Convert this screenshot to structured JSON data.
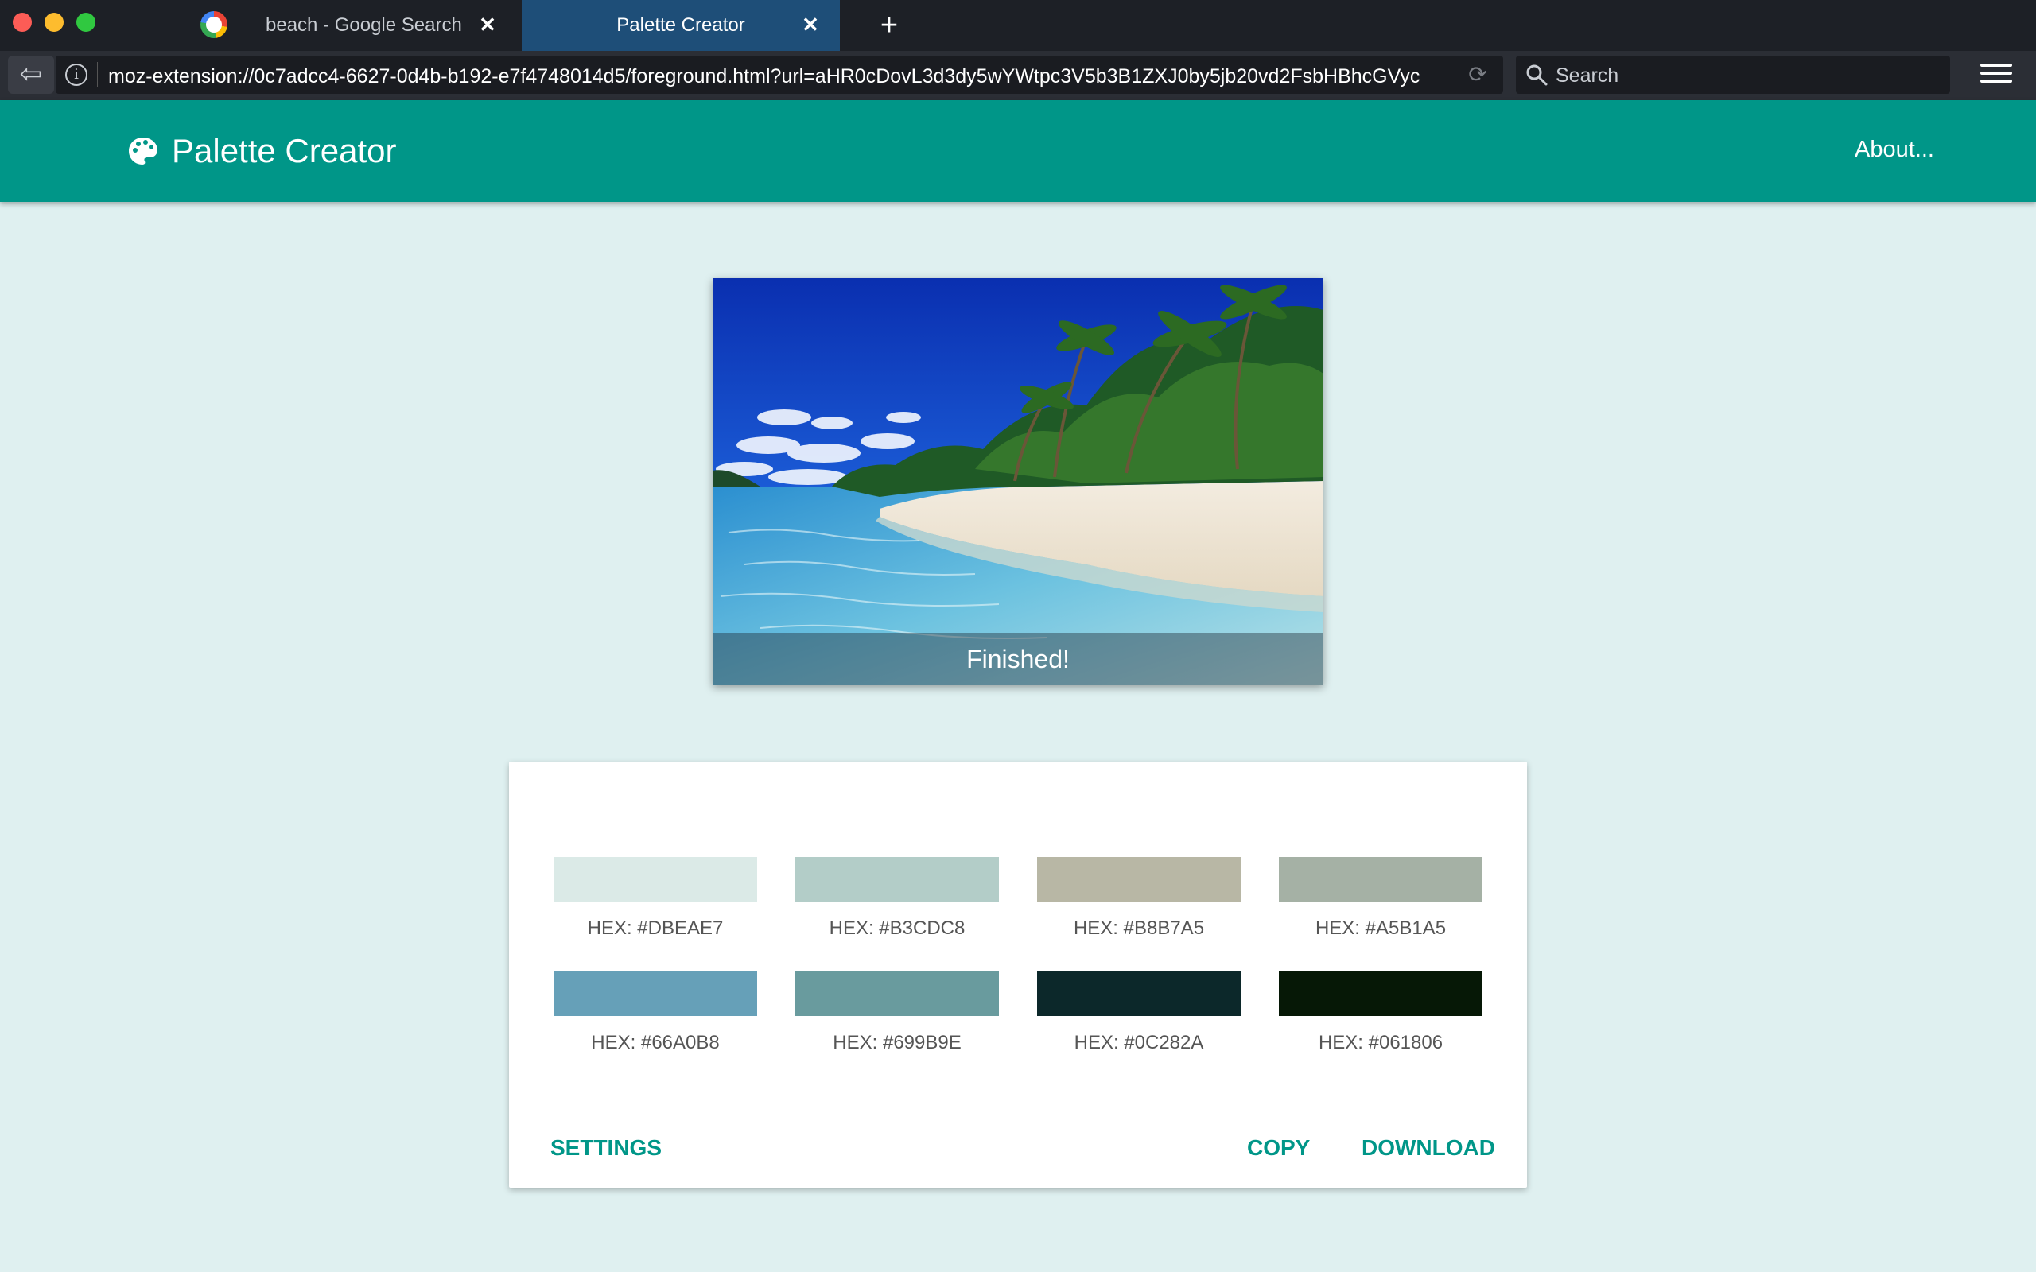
{
  "browser": {
    "tabs": [
      {
        "title": "beach - Google Search",
        "active": false,
        "icon": "google-icon"
      },
      {
        "title": "Palette Creator",
        "active": true
      }
    ],
    "close_glyph": "✕",
    "new_tab_glyph": "+",
    "back_glyph": "⇦",
    "info_glyph": "i",
    "reload_glyph": "⟳",
    "url": "moz-extension://0c7adcc4-6627-0d4b-b192-e7f4748014d5/foreground.html?url=aHR0cDovL3d3dy5wYWtpc3V5b3B1ZXJ0by5jb20vd2FsbHBhcGVyc",
    "search_placeholder": "Search",
    "colors": {
      "titlebar": "#1d2026",
      "active_tab": "#1e4e78",
      "navbar": "#2b2e35"
    }
  },
  "app": {
    "title": "Palette Creator",
    "icon": "palette-icon",
    "about_label": "About...",
    "accent_color": "#009688",
    "background_color": "#dff0f0"
  },
  "image_card": {
    "status": "Finished!",
    "image": "tropical beach with palm trees and turquoise water"
  },
  "palette": {
    "swatches": [
      {
        "hex": "#DBEAE7",
        "label": "HEX: #DBEAE7"
      },
      {
        "hex": "#B3CDC8",
        "label": "HEX: #B3CDC8"
      },
      {
        "hex": "#B8B7A5",
        "label": "HEX: #B8B7A5"
      },
      {
        "hex": "#A5B1A5",
        "label": "HEX: #A5B1A5"
      },
      {
        "hex": "#66A0B8",
        "label": "HEX: #66A0B8"
      },
      {
        "hex": "#699B9E",
        "label": "HEX: #699B9E"
      },
      {
        "hex": "#0C282A",
        "label": "HEX: #0C282A"
      },
      {
        "hex": "#061806",
        "label": "HEX: #061806"
      }
    ],
    "actions": {
      "settings": "SETTINGS",
      "copy": "COPY",
      "download": "DOWNLOAD"
    }
  }
}
